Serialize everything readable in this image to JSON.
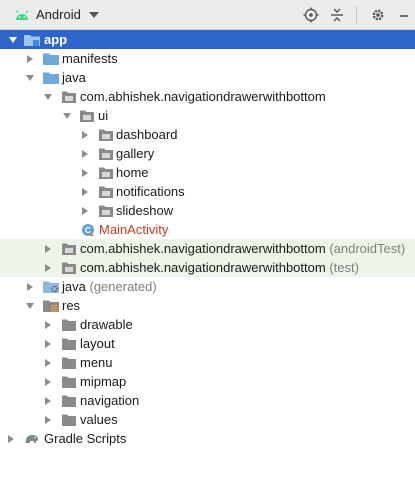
{
  "toolbar": {
    "view": "Android",
    "view_icon": "android-icon",
    "buttons": [
      "locate-icon",
      "collapse-all-icon",
      "gear-icon",
      "minimize-icon"
    ]
  },
  "tree": {
    "app": "app",
    "manifests": "manifests",
    "java": "java",
    "pkg_main": "com.abhishek.navigationdrawerwithbottom",
    "ui": "ui",
    "dashboard": "dashboard",
    "gallery": "gallery",
    "home": "home",
    "notifications": "notifications",
    "slideshow": "slideshow",
    "main_activity": "MainActivity",
    "pkg_android_test": "com.abhishek.navigationdrawerwithbottom",
    "pkg_android_test_suffix": "(androidTest)",
    "pkg_test": "com.abhishek.navigationdrawerwithbottom",
    "pkg_test_suffix": "(test)",
    "java_generated": "java",
    "java_generated_suffix": "(generated)",
    "res": "res",
    "drawable": "drawable",
    "layout": "layout",
    "menu": "menu",
    "mipmap": "mipmap",
    "navigation": "navigation",
    "values": "values",
    "gradle_scripts": "Gradle Scripts"
  },
  "colors": {
    "selection": "#2f65ca",
    "folder_blue": "#6fa8dc",
    "folder_gray": "#8a8a8a",
    "android_green": "#3ddc84",
    "activity_red": "#c8391f"
  }
}
